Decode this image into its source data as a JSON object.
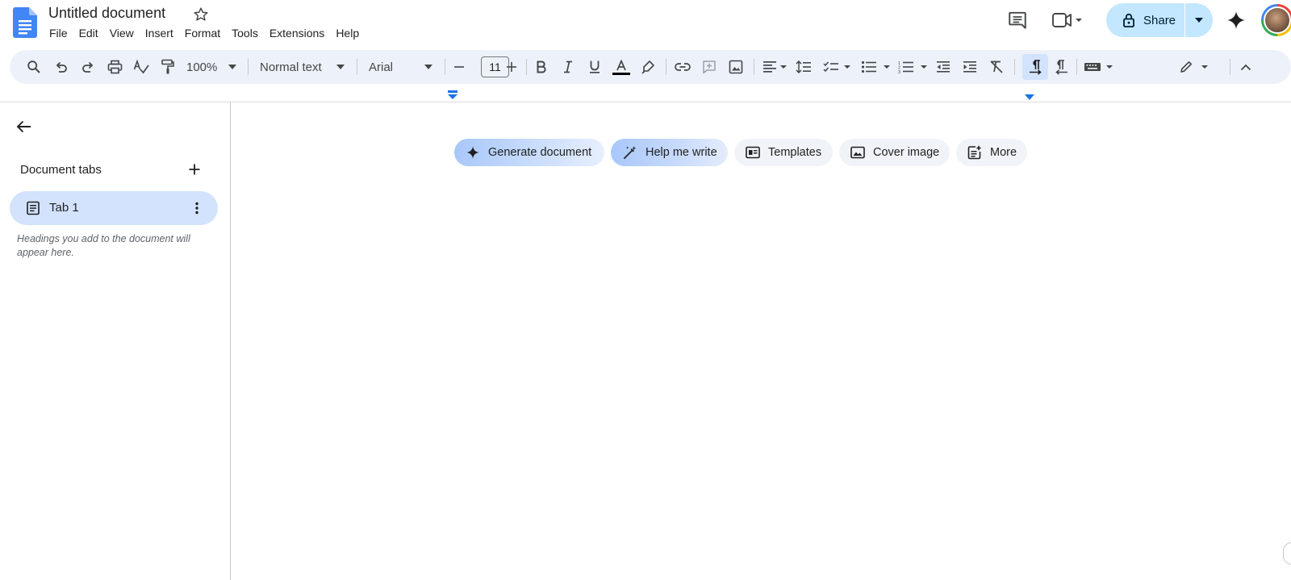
{
  "app": {
    "doc_title": "Untitled document",
    "share_label": "Share"
  },
  "menu": [
    "File",
    "Edit",
    "View",
    "Insert",
    "Format",
    "Tools",
    "Extensions",
    "Help"
  ],
  "toolbar": {
    "zoom": "100%",
    "style": "Normal text",
    "font": "Arial",
    "font_size": "11",
    "text_color": "#000000"
  },
  "sidebar": {
    "heading": "Document tabs",
    "tab_label": "Tab 1",
    "hint": "Headings you add to the document will appear here."
  },
  "chips": [
    {
      "label": "Generate document",
      "icon": "sparkle-icon"
    },
    {
      "label": "Help me write",
      "icon": "magic-pen-icon"
    },
    {
      "label": "Templates",
      "icon": "templates-icon"
    },
    {
      "label": "Cover image",
      "icon": "image-icon"
    },
    {
      "label": "More",
      "icon": "more-add-icon"
    }
  ],
  "colors": {
    "accent": "#0b57d0",
    "share_bg": "#c2e7ff",
    "toolbar_bg": "#edf2fa",
    "tab_active_bg": "#d3e3fd",
    "docs_blue": "#4285f4"
  }
}
